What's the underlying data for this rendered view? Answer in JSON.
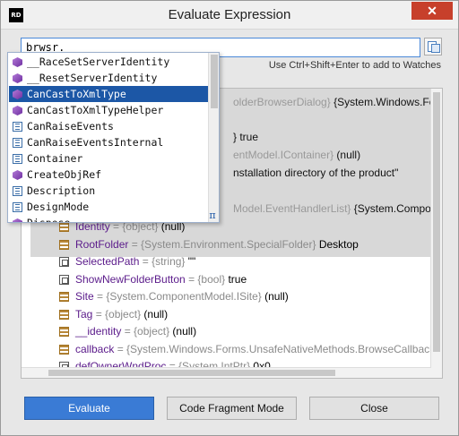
{
  "window": {
    "title": "Evaluate Expression",
    "app_icon": "RD",
    "close": "✕"
  },
  "expression": {
    "value": "brwsr."
  },
  "hint": "Use Ctrl+Shift+Enter to add to Watches",
  "completion": {
    "items": [
      {
        "label": "__RaceSetServerIdentity",
        "icon": "method-icon",
        "selected": false
      },
      {
        "label": "__ResetServerIdentity",
        "icon": "method-icon",
        "selected": false
      },
      {
        "label": "CanCastToXmlType",
        "icon": "method-icon",
        "selected": true
      },
      {
        "label": "CanCastToXmlTypeHelper",
        "icon": "method-icon",
        "selected": false
      },
      {
        "label": "CanRaiseEvents",
        "icon": "property-icon",
        "selected": false
      },
      {
        "label": "CanRaiseEventsInternal",
        "icon": "property-icon",
        "selected": false
      },
      {
        "label": "Container",
        "icon": "property-icon",
        "selected": false
      },
      {
        "label": "CreateObjRef",
        "icon": "method-icon",
        "selected": false
      },
      {
        "label": "Description",
        "icon": "property-icon",
        "selected": false
      },
      {
        "label": "DesignMode",
        "icon": "property-icon",
        "selected": false
      },
      {
        "label": "Dispose",
        "icon": "method-icon",
        "selected": false
      }
    ],
    "pi_glyph": "π"
  },
  "partial_lines": [
    {
      "muted": "olderBrowserDialog}",
      "text": " {System.Windows.Forms.F"
    },
    {
      "muted": "",
      "text": "} true"
    },
    {
      "muted": "entModel.IContainer}",
      "text": " (null)"
    },
    {
      "muted": "",
      "text": "nstallation directory of the product\""
    },
    {
      "muted": "Model.EventHandlerList}",
      "text": " {System.ComponentM"
    }
  ],
  "tree_rows": [
    {
      "name": "Identity",
      "type": " = {object} ",
      "value": "(null)",
      "icon": "field-icon"
    },
    {
      "name": "RootFolder",
      "type": " = {System.Environment.SpecialFolder} ",
      "value": "Desktop",
      "icon": "field-icon"
    },
    {
      "name": "SelectedPath",
      "type": " = {string} ",
      "value": "\"\"",
      "icon": "property-icon"
    },
    {
      "name": "ShowNewFolderButton",
      "type": " = {bool} ",
      "value": "true",
      "icon": "property-icon"
    },
    {
      "name": "Site",
      "type": " = {System.ComponentModel.ISite} ",
      "value": "(null)",
      "icon": "field-icon"
    },
    {
      "name": "Tag",
      "type": " = {object} ",
      "value": "(null)",
      "icon": "field-icon"
    },
    {
      "name": "__identity",
      "type": " = {object} ",
      "value": "(null)",
      "icon": "field-icon"
    },
    {
      "name": "callback",
      "type": " = {System.Windows.Forms.UnsafeNativeMethods.BrowseCallbackPro",
      "value": "",
      "icon": "field-icon"
    },
    {
      "name": "defOwnerWndProc",
      "type": " = {System.IntPtr} ",
      "value": "0x0",
      "icon": "property-icon"
    }
  ],
  "buttons": {
    "evaluate": "Evaluate",
    "code_fragment": "Code Fragment Mode",
    "close": "Close"
  },
  "colors": {
    "accent": "#3a7bd5",
    "selection": "#1c57a6",
    "close_red": "#c7402b"
  }
}
